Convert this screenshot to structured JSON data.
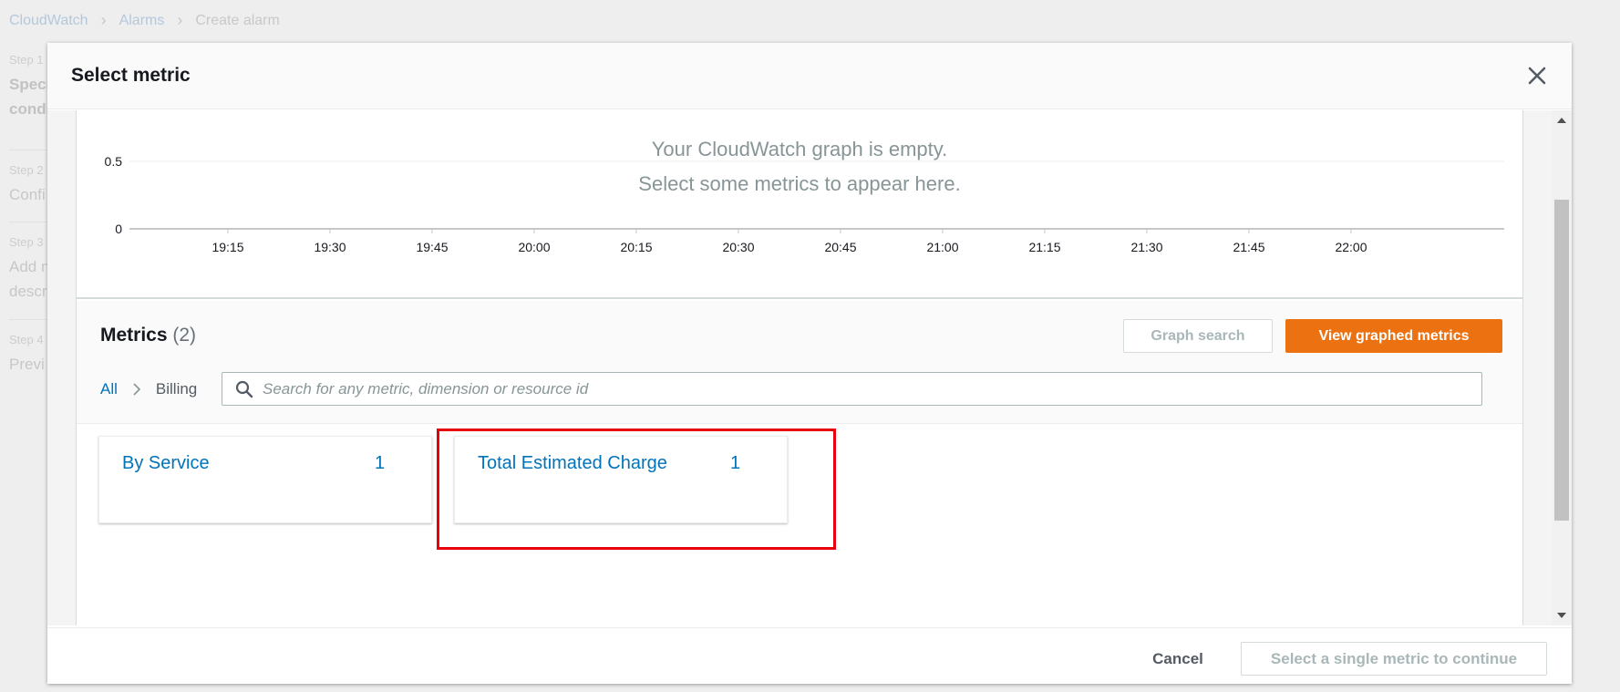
{
  "background": {
    "breadcrumb": {
      "items": [
        "CloudWatch",
        "Alarms"
      ],
      "current": "Create alarm"
    },
    "steps": [
      {
        "label": "Step 1",
        "title_lines": [
          "Speci",
          "condi"
        ]
      },
      {
        "label": "Step 2",
        "title_lines": [
          "Confi"
        ]
      },
      {
        "label": "Step 3",
        "title_lines": [
          "Add n",
          "descri"
        ]
      },
      {
        "label": "Step 4",
        "title_lines": [
          "Previ"
        ]
      }
    ]
  },
  "modal": {
    "title": "Select metric",
    "graph": {
      "empty_line1": "Your CloudWatch graph is empty.",
      "empty_line2": "Select some metrics to appear here.",
      "y_ticks": [
        "0.5",
        "0"
      ],
      "x_ticks": [
        "19:15",
        "19:30",
        "19:45",
        "20:00",
        "20:15",
        "20:30",
        "20:45",
        "21:00",
        "21:15",
        "21:30",
        "21:45",
        "22:00"
      ]
    },
    "drag_handle": "=",
    "metrics": {
      "title": "Metrics",
      "count": "(2)",
      "graph_search_label": "Graph search",
      "view_graphed_label": "View graphed metrics",
      "crumb_all": "All",
      "crumb_billing": "Billing",
      "search_placeholder": "Search for any metric, dimension or resource id",
      "cards": [
        {
          "name": "By Service",
          "count": "1"
        },
        {
          "name": "Total Estimated Charge",
          "count": "1"
        }
      ]
    },
    "footer": {
      "cancel_label": "Cancel",
      "continue_label": "Select a single metric to continue"
    }
  },
  "colors": {
    "accent_orange": "#ec7211",
    "link_blue": "#0073bb",
    "highlight_red": "#e8000d"
  }
}
